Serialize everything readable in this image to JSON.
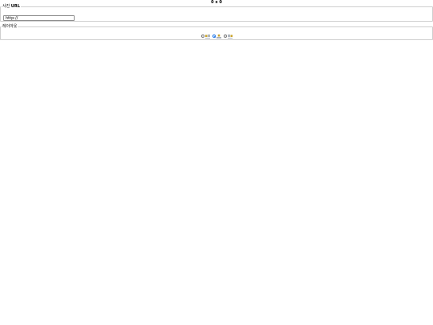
{
  "header": {
    "size_readout": "0 x 0"
  },
  "url_section": {
    "legend_prefix": "사진 ",
    "legend_bold": "URL",
    "input_value": "http://"
  },
  "layout_section": {
    "legend": "레이아웃",
    "options": [
      {
        "icon": "image-left-layout-icon",
        "checked": false
      },
      {
        "icon": "image-center-layout-icon",
        "checked": true
      },
      {
        "icon": "image-right-layout-icon",
        "checked": false
      }
    ]
  },
  "colors": {
    "border": "#cfcfcf",
    "radio_checked": "#1a73e8",
    "icon_image": "#c9a227",
    "icon_text": "#5f6b7a"
  }
}
